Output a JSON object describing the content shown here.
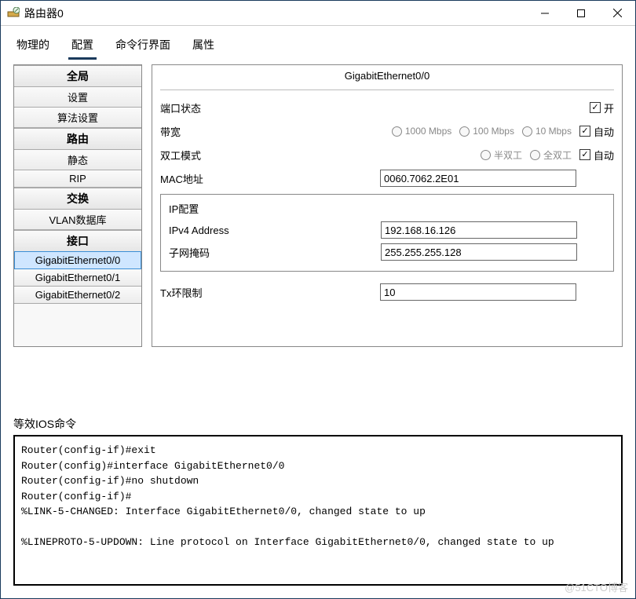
{
  "window": {
    "title": "路由器0"
  },
  "tabs": {
    "physical": "物理的",
    "config": "配置",
    "cli": "命令行界面",
    "attributes": "属性"
  },
  "sidebar": {
    "headers": {
      "global": "全局",
      "routing": "路由",
      "switching": "交换",
      "interface": "接口"
    },
    "global_items": {
      "settings": "设置",
      "algorithm": "算法设置"
    },
    "routing_items": {
      "static": "静态",
      "rip": "RIP"
    },
    "switching_items": {
      "vlan": "VLAN数据库"
    },
    "interface_items": {
      "ge00": "GigabitEthernet0/0",
      "ge01": "GigabitEthernet0/1",
      "ge02": "GigabitEthernet0/2"
    }
  },
  "panel": {
    "title": "GigabitEthernet0/0",
    "port_status_label": "端口状态",
    "on_label": "开",
    "bandwidth_label": "带宽",
    "bw_1000": "1000 Mbps",
    "bw_100": "100 Mbps",
    "bw_10": "10 Mbps",
    "auto_label": "自动",
    "duplex_label": "双工模式",
    "half_duplex": "半双工",
    "full_duplex": "全双工",
    "mac_label": "MAC地址",
    "mac_value": "0060.7062.2E01",
    "ip_group_label": "IP配置",
    "ipv4_label": "IPv4 Address",
    "ipv4_value": "192.168.16.126",
    "subnet_label": "子网掩码",
    "subnet_value": "255.255.255.128",
    "tx_label": "Tx环限制",
    "tx_value": "10"
  },
  "ios": {
    "label": "等效IOS命令",
    "output": "Router(config-if)#exit\nRouter(config)#interface GigabitEthernet0/0\nRouter(config-if)#no shutdown\nRouter(config-if)#\n%LINK-5-CHANGED: Interface GigabitEthernet0/0, changed state to up\n\n%LINEPROTO-5-UPDOWN: Line protocol on Interface GigabitEthernet0/0, changed state to up\n"
  },
  "watermark": "@51CTO博客"
}
